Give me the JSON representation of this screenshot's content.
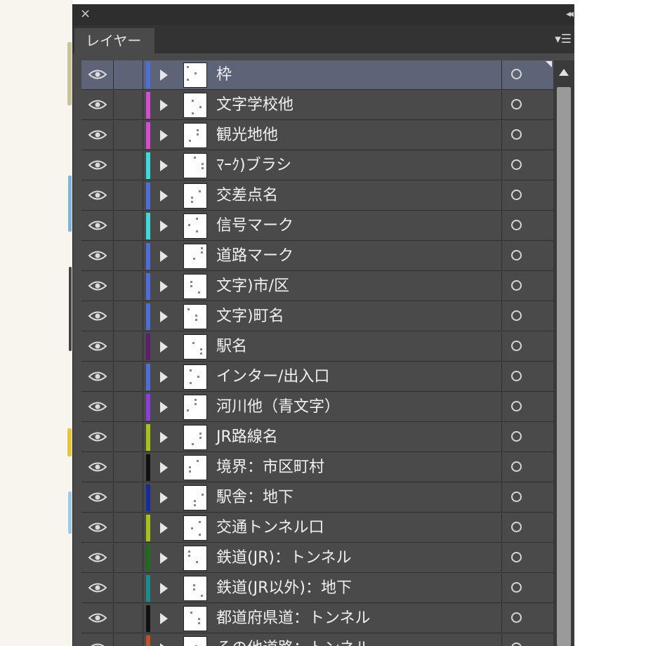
{
  "panel": {
    "close_icon": "×",
    "collapse_icon": "◂◂",
    "tab_label": "レイヤー",
    "menu_icon": "▾☰"
  },
  "colors": {
    "panel_bg": "#4a4a4a",
    "selected_row": "#5d6478"
  },
  "layers": [
    {
      "name": "枠",
      "color": "#4f6fd6",
      "selected": true
    },
    {
      "name": "文字学校他",
      "color": "#d24fd2"
    },
    {
      "name": "観光地他",
      "color": "#d24fd2"
    },
    {
      "name": "ﾏｰｸ)ブラシ",
      "color": "#3ed9d9"
    },
    {
      "name": "交差点名",
      "color": "#4f6fd6"
    },
    {
      "name": "信号マーク",
      "color": "#3ed9d9"
    },
    {
      "name": "道路マーク",
      "color": "#4f6fd6"
    },
    {
      "name": "文字)市/区",
      "color": "#4f6fd6"
    },
    {
      "name": "文字)町名",
      "color": "#4f6fd6"
    },
    {
      "name": "駅名",
      "color": "#5a1f6e"
    },
    {
      "name": "インター/出入口",
      "color": "#4f6fd6"
    },
    {
      "name": "河川他（青文字）",
      "color": "#8a3fd6"
    },
    {
      "name": "JR路線名",
      "color": "#a8c21c"
    },
    {
      "name": "境界：市区町村",
      "color": "#111111"
    },
    {
      "name": "駅舎：地下",
      "color": "#1a2a9a"
    },
    {
      "name": "交通トンネル口",
      "color": "#a8c21c"
    },
    {
      "name": "鉄道(JR)：トンネル",
      "color": "#1f6a1f"
    },
    {
      "name": "鉄道(JR以外)：地下",
      "color": "#1e8a8a"
    },
    {
      "name": "都道府県道：トンネル",
      "color": "#111111"
    },
    {
      "name": "その他道路：トンネル",
      "color": "#c0502a"
    }
  ]
}
